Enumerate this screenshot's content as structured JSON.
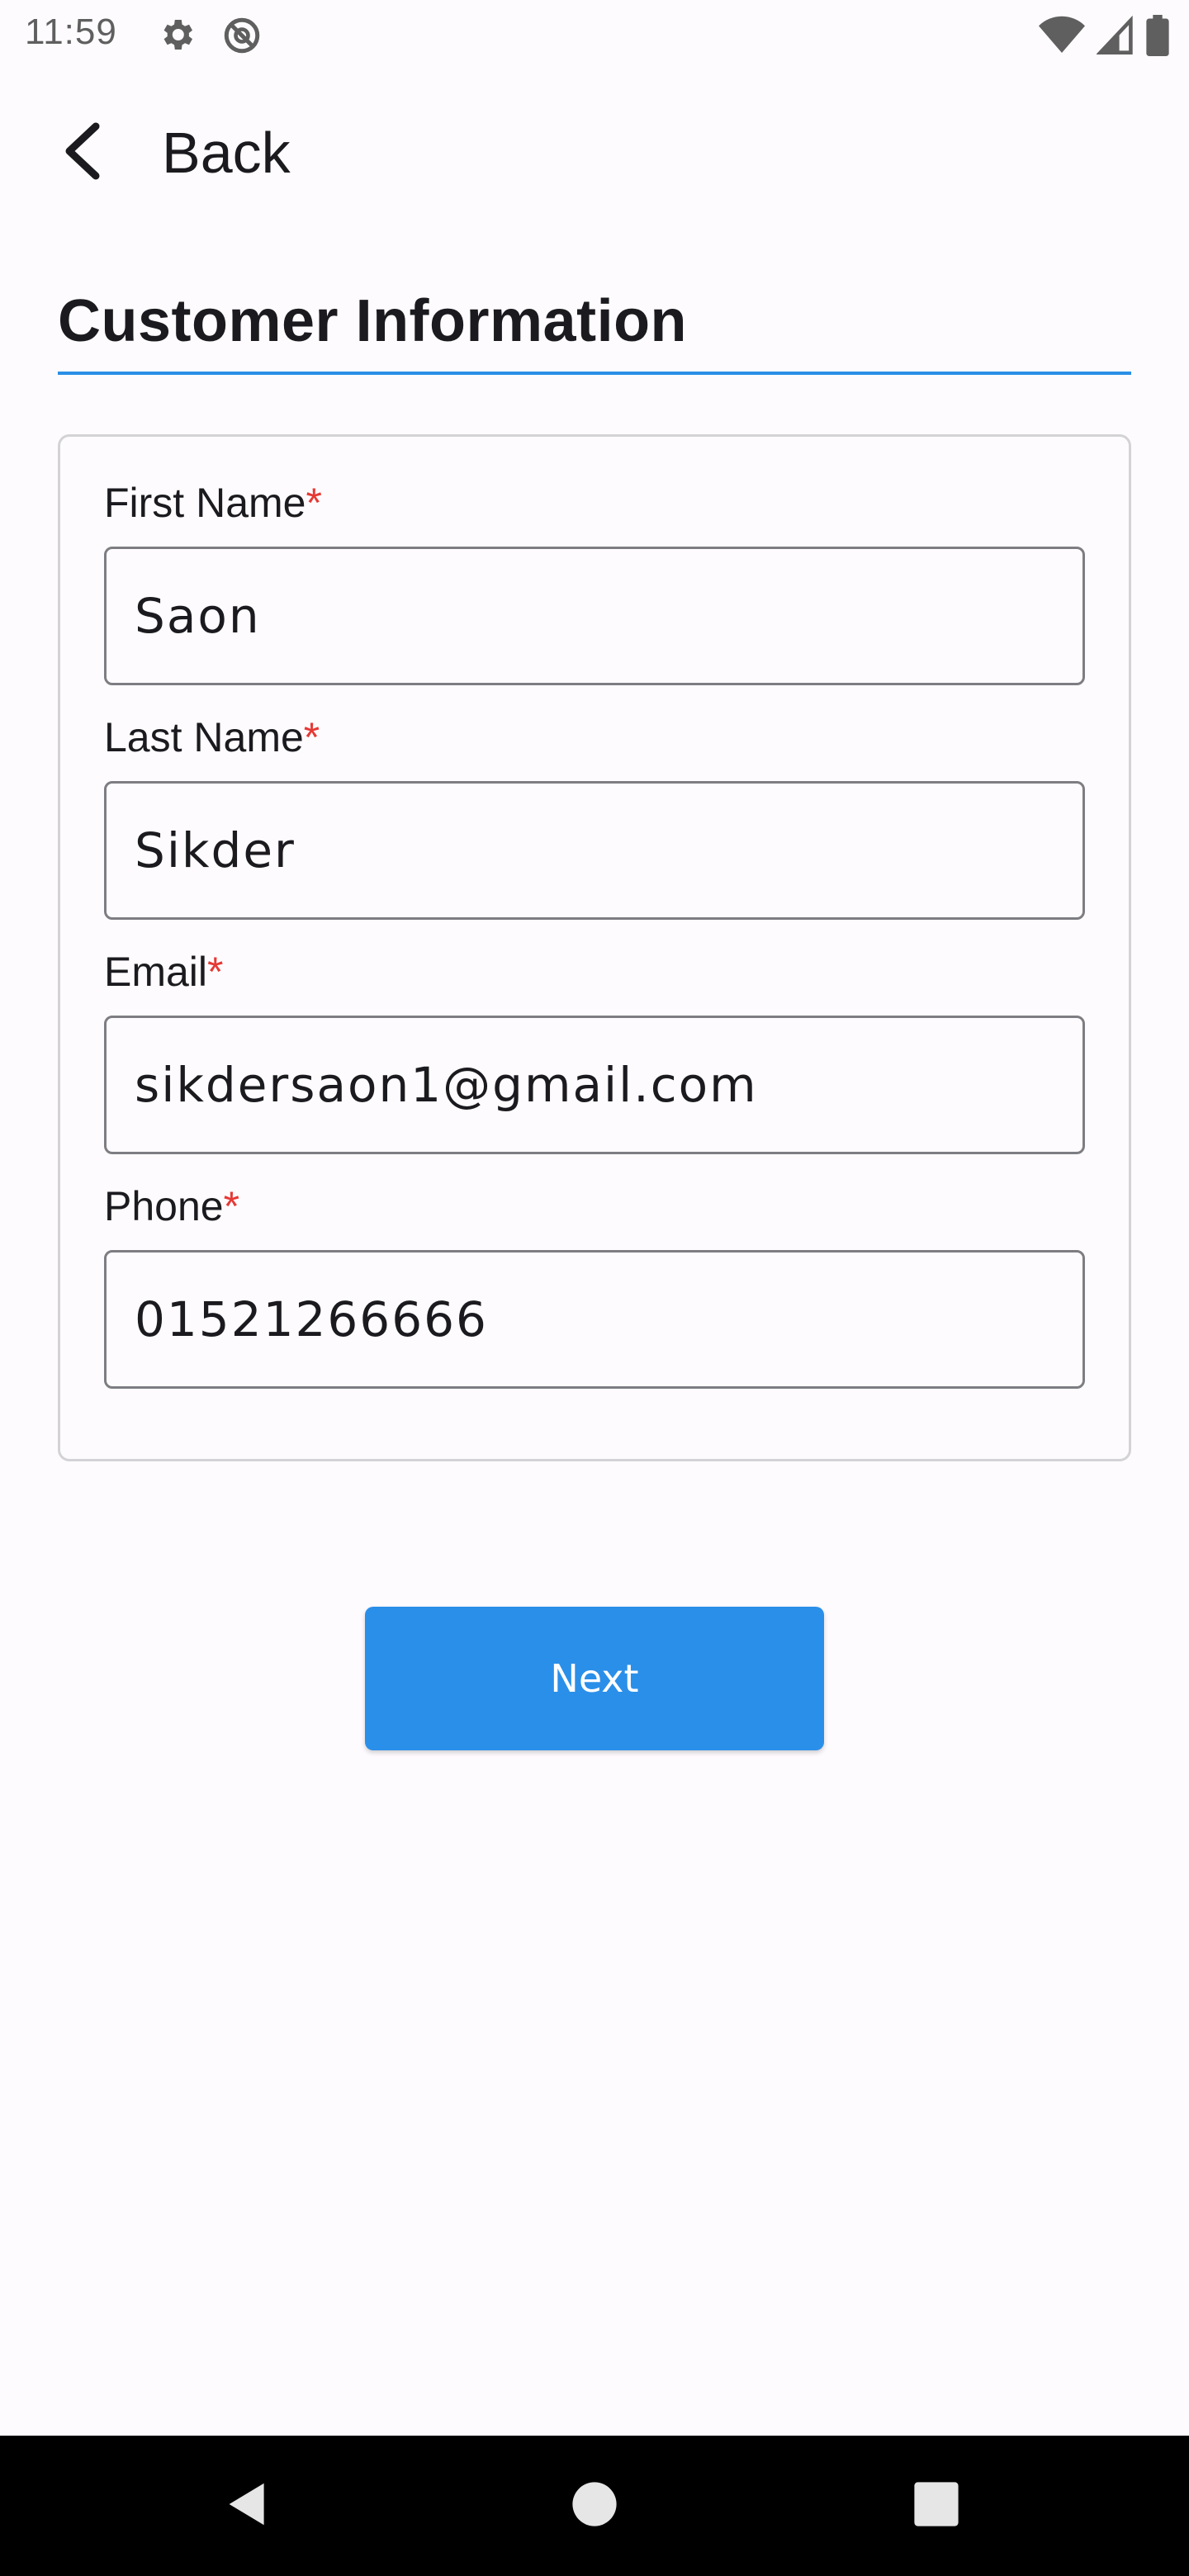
{
  "status_bar": {
    "time": "11:59",
    "icons": [
      "gear-icon",
      "do-not-disturb-icon",
      "wifi-icon",
      "signal-icon",
      "battery-icon"
    ]
  },
  "app_bar": {
    "back_label": "Back",
    "back_icon": "chevron-left-icon"
  },
  "section": {
    "title": "Customer Information",
    "accent_color": "#2a8fe6"
  },
  "form": {
    "required_marker": "*",
    "fields": [
      {
        "label": "First Name",
        "value": "Saon"
      },
      {
        "label": "Last Name",
        "value": "Sikder"
      },
      {
        "label": "Email",
        "value": "sikdersaon1@gmail.com"
      },
      {
        "label": "Phone",
        "value": "01521266666"
      }
    ]
  },
  "actions": {
    "next_label": "Next",
    "button_color": "#2a8fe9"
  },
  "nav_bar": {
    "icons": [
      "back-triangle-icon",
      "home-circle-icon",
      "recents-square-icon"
    ]
  }
}
